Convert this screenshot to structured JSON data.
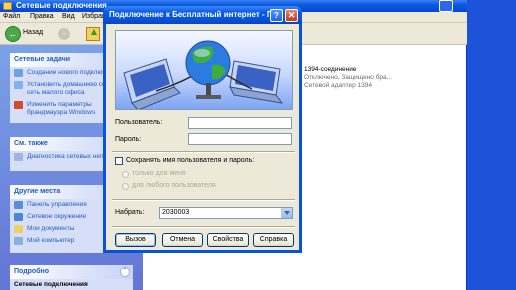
{
  "explorer": {
    "title": "Сетевые подключения",
    "menu": [
      "Файл",
      "Правка",
      "Вид",
      "Избранное"
    ],
    "back_label": "Назад",
    "panels": [
      {
        "title": "Сетевые задачи",
        "items": [
          "Создание нового подключения",
          "Установить домашнюю сеть или сеть малого офиса",
          "Изменить параметры брандмауэра Windows"
        ]
      },
      {
        "title": "См. также",
        "items": [
          "Диагностика сетевых неполадок"
        ]
      },
      {
        "title": "Другие места",
        "items": [
          "Панель управления",
          "Сетевое окружение",
          "Мои документы",
          "Мой компьютер"
        ]
      },
      {
        "title": "Подробно",
        "items": [
          "Сетевые подключения"
        ]
      }
    ],
    "connection": {
      "name": "1394-соединение",
      "status": "Отключено, Защищено бра...",
      "device": "Сетевой адаптер 1394"
    }
  },
  "dialog": {
    "title": "Подключение к Бесплатный интернет - П...",
    "help_button": "?",
    "close_button": "✕",
    "user_label": "Пользователь:",
    "user_value": "",
    "password_label": "Пароль:",
    "password_value": "",
    "save_checkbox_label": "Сохранять имя пользователя и пароль:",
    "radio_me": "только для меня",
    "radio_all": "для любого пользователя",
    "dial_label": "Набрать:",
    "dial_value": "2030003",
    "buttons": {
      "dial": "Вызов",
      "cancel": "Отмена",
      "properties": "Свойства",
      "help": "Справка"
    }
  },
  "colors": {
    "title_blue": "#0a5ae4",
    "dialog_face": "#ece9d8",
    "sidebar_link": "#215dc6",
    "close_red": "#c4391d"
  }
}
